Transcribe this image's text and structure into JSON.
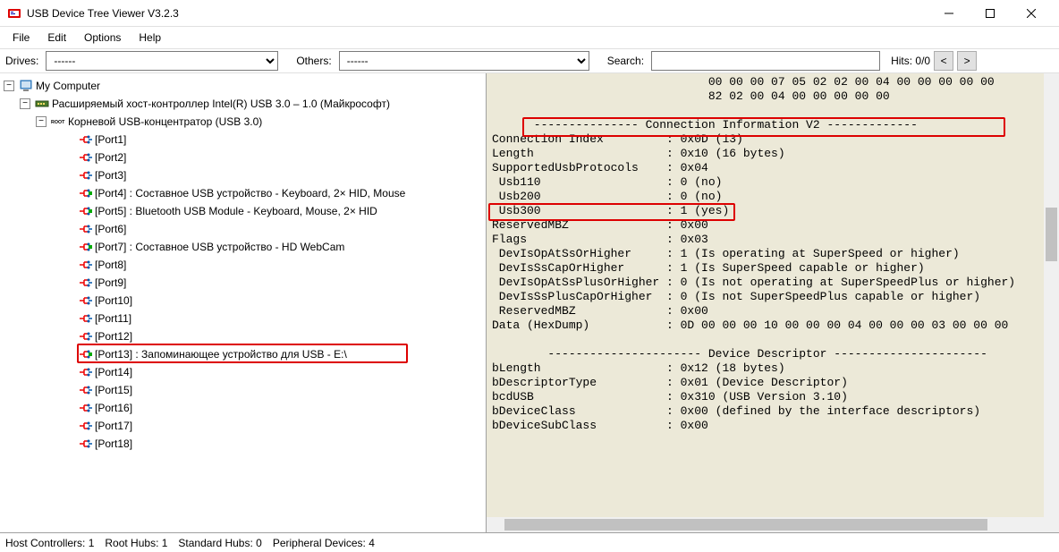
{
  "window": {
    "title": "USB Device Tree Viewer V3.2.3"
  },
  "menu": {
    "file": "File",
    "edit": "Edit",
    "options": "Options",
    "help": "Help"
  },
  "toolbar": {
    "drives_label": "Drives:",
    "drives_value": "------",
    "others_label": "Others:",
    "others_value": "------",
    "search_label": "Search:",
    "search_value": "",
    "hits_label": "Hits:",
    "hits_value": "0/0"
  },
  "tree": {
    "root": "My Computer",
    "controller": "Расширяемый хост-контроллер Intel(R) USB 3.0 – 1.0 (Майкрософт)",
    "hub": "Корневой USB-концентратор (USB 3.0)",
    "ports": [
      "[Port1]",
      "[Port2]",
      "[Port3]",
      "[Port4] : Составное USB устройство - Keyboard, 2× HID, Mouse",
      "[Port5] : Bluetooth USB Module - Keyboard, Mouse, 2× HID",
      "[Port6]",
      "[Port7] : Составное USB устройство - HD WebCam",
      "[Port8]",
      "[Port9]",
      "[Port10]",
      "[Port11]",
      "[Port12]",
      "[Port13] : Запоминающее устройство для USB - E:\\",
      "[Port14]",
      "[Port15]",
      "[Port16]",
      "[Port17]",
      "[Port18]"
    ]
  },
  "detail": {
    "lines": [
      "                               00 00 00 07 05 02 02 00 04 00 00 00 00 00",
      "                               82 02 00 04 00 00 00 00 00",
      "",
      "      --------------- Connection Information V2 -------------",
      "Connection Index         : 0x0D (13)",
      "Length                   : 0x10 (16 bytes)",
      "SupportedUsbProtocols    : 0x04",
      " Usb110                  : 0 (no)",
      " Usb200                  : 0 (no)",
      " Usb300                  : 1 (yes)",
      "ReservedMBZ              : 0x00",
      "Flags                    : 0x03",
      " DevIsOpAtSsOrHigher     : 1 (Is operating at SuperSpeed or higher)",
      " DevIsSsCapOrHigher      : 1 (Is SuperSpeed capable or higher)",
      " DevIsOpAtSsPlusOrHigher : 0 (Is not operating at SuperSpeedPlus or higher)",
      " DevIsSsPlusCapOrHigher  : 0 (Is not SuperSpeedPlus capable or higher)",
      " ReservedMBZ             : 0x00",
      "Data (HexDump)           : 0D 00 00 00 10 00 00 00 04 00 00 00 03 00 00 00",
      "",
      "        ---------------------- Device Descriptor ----------------------",
      "bLength                  : 0x12 (18 bytes)",
      "bDescriptorType          : 0x01 (Device Descriptor)",
      "bcdUSB                   : 0x310 (USB Version 3.10)",
      "bDeviceClass             : 0x00 (defined by the interface descriptors)",
      "bDeviceSubClass          : 0x00"
    ]
  },
  "status": {
    "host_controllers": "Host Controllers: 1",
    "root_hubs": "Root Hubs: 1",
    "standard_hubs": "Standard Hubs: 0",
    "peripheral": "Peripheral Devices: 4"
  }
}
